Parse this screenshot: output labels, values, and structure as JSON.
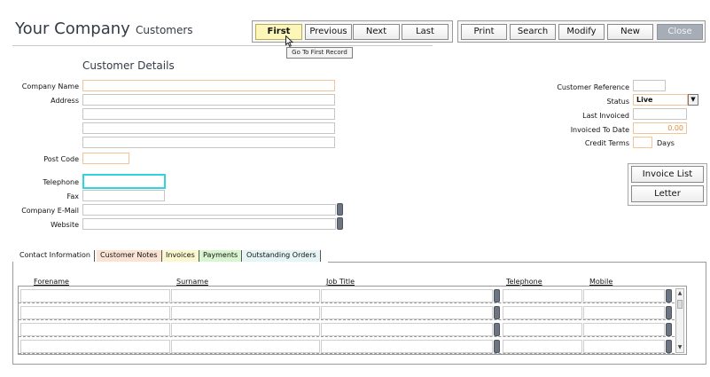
{
  "header": {
    "app_title": "Your Company",
    "module_title": "Customers"
  },
  "nav_buttons": {
    "first": "First",
    "previous": "Previous",
    "next": "Next",
    "last": "Last"
  },
  "action_buttons": {
    "print": "Print",
    "search": "Search",
    "modify": "Modify",
    "new": "New",
    "close": "Close"
  },
  "tooltip": "Go To First Record",
  "section_title": "Customer Details",
  "left_form": {
    "company_name_label": "Company Name",
    "address_label": "Address",
    "post_code_label": "Post Code",
    "telephone_label": "Telephone",
    "fax_label": "Fax",
    "email_label": "Company E-Mail",
    "website_label": "Website",
    "company_name_value": "",
    "telephone_value": ""
  },
  "right_form": {
    "customer_reference_label": "Customer Reference",
    "status_label": "Status",
    "status_value": "Live",
    "last_invoiced_label": "Last Invoiced",
    "invoiced_to_date_label": "Invoiced To Date",
    "invoiced_to_date_value": "0.00",
    "credit_terms_label": "Credit Terms",
    "credit_terms_unit": "Days"
  },
  "side_buttons": {
    "invoice_list": "Invoice List",
    "letter": "Letter"
  },
  "tabs": [
    {
      "label": "Contact Information",
      "color": "#ffffff"
    },
    {
      "label": "Customer Notes",
      "color": "#fbe3d3"
    },
    {
      "label": "Invoices",
      "color": "#fbf8cf"
    },
    {
      "label": "Payments",
      "color": "#d9f5d0"
    },
    {
      "label": "Outstanding Orders",
      "color": "#e5f5f5"
    }
  ],
  "contacts_table": {
    "columns": [
      "Forename",
      "Surname",
      "Job Title",
      "Telephone",
      "Mobile"
    ],
    "rows": [
      [],
      [],
      [],
      []
    ]
  },
  "icons": {
    "dropdown": "chevron-down-icon",
    "scroll_up": "arrow-up-icon",
    "scroll_down": "arrow-down-icon"
  }
}
